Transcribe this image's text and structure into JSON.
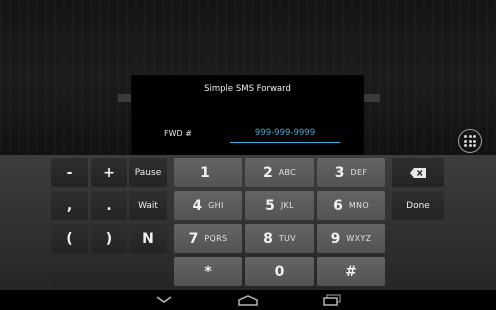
{
  "dialog": {
    "title": "Simple SMS Forward",
    "field_label": "FWD #",
    "field_placeholder": "999-999-9999",
    "field_value": ""
  },
  "keyboard": {
    "left_keys": [
      "-",
      "+",
      "Pause",
      ",",
      ".",
      "Wait",
      "(",
      ")",
      "N"
    ],
    "num_keys": [
      {
        "digit": "1",
        "letters": ""
      },
      {
        "digit": "2",
        "letters": "ABC"
      },
      {
        "digit": "3",
        "letters": "DEF"
      },
      {
        "digit": "4",
        "letters": "GHI"
      },
      {
        "digit": "5",
        "letters": "JKL"
      },
      {
        "digit": "6",
        "letters": "MNO"
      },
      {
        "digit": "7",
        "letters": "PQRS"
      },
      {
        "digit": "8",
        "letters": "TUV"
      },
      {
        "digit": "9",
        "letters": "WXYZ"
      },
      {
        "digit": "*",
        "letters": ""
      },
      {
        "digit": "0",
        "letters": ""
      },
      {
        "digit": "#",
        "letters": ""
      }
    ],
    "done_label": "Done",
    "backspace_icon": "backspace-icon"
  },
  "navbar": {
    "icons": [
      "hide-keyboard-icon",
      "home-icon",
      "recent-apps-icon"
    ]
  },
  "colors": {
    "accent": "#33b5e5",
    "dialog_bg": "#000000",
    "keyboard_bg": "#333333"
  }
}
